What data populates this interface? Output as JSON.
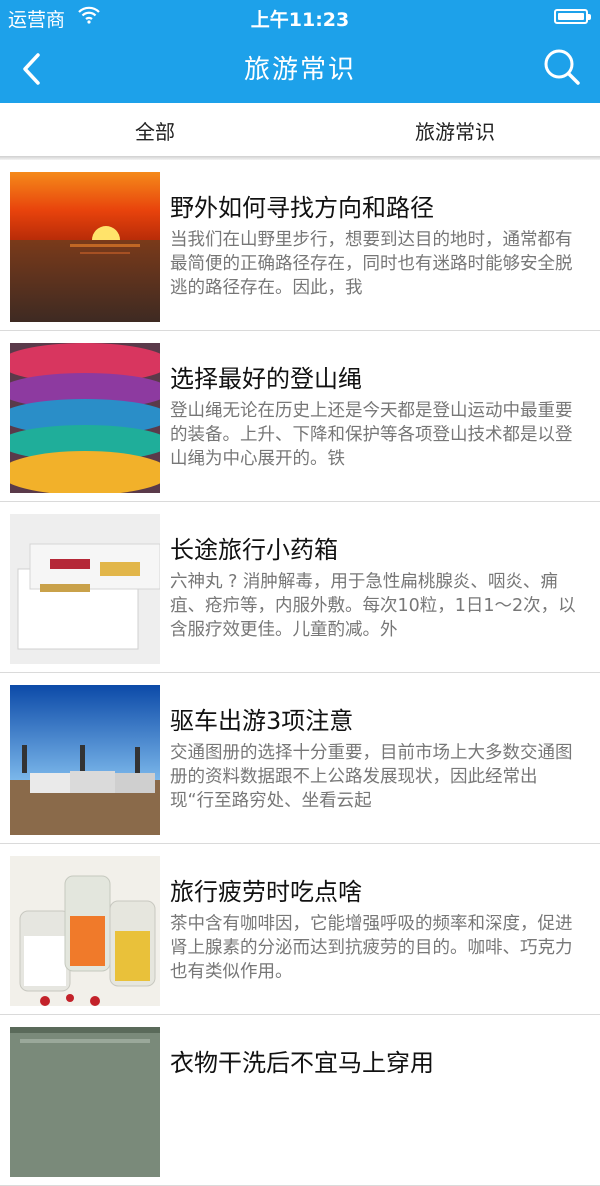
{
  "status_bar": {
    "carrier": "运营商",
    "time": "上午11:23"
  },
  "nav": {
    "title": "旅游常识"
  },
  "tabs": [
    {
      "label": "全部"
    },
    {
      "label": "旅游常识"
    }
  ],
  "articles": [
    {
      "title": "野外如何寻找方向和路径",
      "desc": "当我们在山野里步行，想要到达目的地时，通常都有最简便的正确路径存在，同时也有迷路时能够安全脱逃的路径存在。因此，我"
    },
    {
      "title": "选择最好的登山绳",
      "desc": "登山绳无论在历史上还是今天都是登山运动中最重要的装备。上升、下降和保护等各项登山技术都是以登山绳为中心展开的。铁"
    },
    {
      "title": "长途旅行小药箱",
      "desc": "六神丸 ? 消肿解毒，用于急性扁桃腺炎、咽炎、痈疽、疮疖等，内服外敷。每次10粒，1日1～2次，以含服疗效更佳。儿童酌减。外"
    },
    {
      "title": "驱车出游3项注意",
      "desc": "交通图册的选择十分重要，目前市场上大多数交通图册的资料数据跟不上公路发展现状，因此经常出现“行至路穷处、坐看云起"
    },
    {
      "title": "旅行疲劳时吃点啥",
      "desc": "茶中含有咖啡因，它能增强呼吸的频率和深度，促进肾上腺素的分泌而达到抗疲劳的目的。咖啡、巧克力也有类似作用。"
    },
    {
      "title": "衣物干洗后不宜马上穿用",
      "desc": ""
    }
  ]
}
